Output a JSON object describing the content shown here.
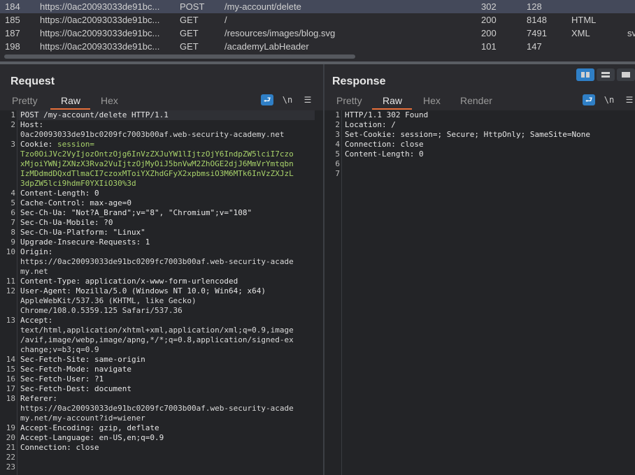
{
  "history": {
    "rows": [
      {
        "num": "184",
        "host": "https://0ac20093033de91bc...",
        "method": "POST",
        "url": "/my-account/delete",
        "status": "302",
        "length": "128",
        "mime": "",
        "ext": "",
        "selected": true
      },
      {
        "num": "185",
        "host": "https://0ac20093033de91bc...",
        "method": "GET",
        "url": "/",
        "status": "200",
        "length": "8148",
        "mime": "HTML",
        "ext": ""
      },
      {
        "num": "187",
        "host": "https://0ac20093033de91bc...",
        "method": "GET",
        "url": "/resources/images/blog.svg",
        "status": "200",
        "length": "7491",
        "mime": "XML",
        "ext": "sv"
      },
      {
        "num": "198",
        "host": "https://0ac20093033de91bc...",
        "method": "GET",
        "url": "/academyLabHeader",
        "status": "101",
        "length": "147",
        "mime": "",
        "ext": ""
      }
    ]
  },
  "request": {
    "title": "Request",
    "tabs": [
      "Pretty",
      "Raw",
      "Hex"
    ],
    "active_tab": "Raw",
    "wrap_icon": "wrap-lines-icon",
    "newline_label": "\\n",
    "menu_icon": "hamburger-menu-icon",
    "lines": [
      {
        "n": "1",
        "segs": [
          {
            "t": "POST /my-account/delete HTTP/1.1",
            "c": "k"
          }
        ]
      },
      {
        "n": "2",
        "segs": [
          {
            "t": "Host:",
            "c": "k"
          }
        ]
      },
      {
        "n": "",
        "segs": [
          {
            "t": "0ac20093033de91bc0209fc7003b00af.web-security-academy.net",
            "c": "v"
          }
        ]
      },
      {
        "n": "3",
        "segs": [
          {
            "t": "Cookie: ",
            "c": "k"
          },
          {
            "t": "session=",
            "c": "cv"
          }
        ]
      },
      {
        "n": "",
        "segs": [
          {
            "t": "Tzo0OiJVc2VyIjozOntzOjg6InVzZXJuYW1lIjtzOjY6IndpZW5lciI7czo",
            "c": "cv"
          }
        ]
      },
      {
        "n": "",
        "segs": [
          {
            "t": "xMjoiYWNjZXNzX3Rva2VuIjtzOjMyOiJ5bnVwM2ZhOGE2djJ6MmVrYmtqbn",
            "c": "cv"
          }
        ]
      },
      {
        "n": "",
        "segs": [
          {
            "t": "IzMDdmdDQxdTlmaCI7czoxMToiYXZhdGFyX2xpbmsiO3M6MTk6InVzZXJzL",
            "c": "cv"
          }
        ]
      },
      {
        "n": "",
        "segs": [
          {
            "t": "3dpZW5lci9hdmF0YXIiO30%3d",
            "c": "cv"
          }
        ]
      },
      {
        "n": "4",
        "segs": [
          {
            "t": "Content-Length: 0",
            "c": "k"
          }
        ]
      },
      {
        "n": "5",
        "segs": [
          {
            "t": "Cache-Control: max-age=0",
            "c": "k"
          }
        ]
      },
      {
        "n": "6",
        "segs": [
          {
            "t": "Sec-Ch-Ua: \"Not?A_Brand\";v=\"8\", \"Chromium\";v=\"108\"",
            "c": "k"
          }
        ]
      },
      {
        "n": "7",
        "segs": [
          {
            "t": "Sec-Ch-Ua-Mobile: ?0",
            "c": "k"
          }
        ]
      },
      {
        "n": "8",
        "segs": [
          {
            "t": "Sec-Ch-Ua-Platform: \"Linux\"",
            "c": "k"
          }
        ]
      },
      {
        "n": "9",
        "segs": [
          {
            "t": "Upgrade-Insecure-Requests: 1",
            "c": "k"
          }
        ]
      },
      {
        "n": "10",
        "segs": [
          {
            "t": "Origin:",
            "c": "k"
          }
        ]
      },
      {
        "n": "",
        "segs": [
          {
            "t": "https://0ac20093033de91bc0209fc7003b00af.web-security-acade",
            "c": "v"
          }
        ]
      },
      {
        "n": "",
        "segs": [
          {
            "t": "my.net",
            "c": "v"
          }
        ]
      },
      {
        "n": "11",
        "segs": [
          {
            "t": "Content-Type: application/x-www-form-urlencoded",
            "c": "k"
          }
        ]
      },
      {
        "n": "12",
        "segs": [
          {
            "t": "User-Agent: Mozilla/5.0 (Windows NT 10.0; Win64; x64)",
            "c": "k"
          }
        ]
      },
      {
        "n": "",
        "segs": [
          {
            "t": "AppleWebKit/537.36 (KHTML, like Gecko)",
            "c": "v"
          }
        ]
      },
      {
        "n": "",
        "segs": [
          {
            "t": "Chrome/108.0.5359.125 Safari/537.36",
            "c": "v"
          }
        ]
      },
      {
        "n": "13",
        "segs": [
          {
            "t": "Accept:",
            "c": "k"
          }
        ]
      },
      {
        "n": "",
        "segs": [
          {
            "t": "text/html,application/xhtml+xml,application/xml;q=0.9,image",
            "c": "v"
          }
        ]
      },
      {
        "n": "",
        "segs": [
          {
            "t": "/avif,image/webp,image/apng,*/*;q=0.8,application/signed-ex",
            "c": "v"
          }
        ]
      },
      {
        "n": "",
        "segs": [
          {
            "t": "change;v=b3;q=0.9",
            "c": "v"
          }
        ]
      },
      {
        "n": "14",
        "segs": [
          {
            "t": "Sec-Fetch-Site: same-origin",
            "c": "k"
          }
        ]
      },
      {
        "n": "15",
        "segs": [
          {
            "t": "Sec-Fetch-Mode: navigate",
            "c": "k"
          }
        ]
      },
      {
        "n": "16",
        "segs": [
          {
            "t": "Sec-Fetch-User: ?1",
            "c": "k"
          }
        ]
      },
      {
        "n": "17",
        "segs": [
          {
            "t": "Sec-Fetch-Dest: document",
            "c": "k"
          }
        ]
      },
      {
        "n": "18",
        "segs": [
          {
            "t": "Referer:",
            "c": "k"
          }
        ]
      },
      {
        "n": "",
        "segs": [
          {
            "t": "https://0ac20093033de91bc0209fc7003b00af.web-security-acade",
            "c": "v"
          }
        ]
      },
      {
        "n": "",
        "segs": [
          {
            "t": "my.net/my-account?id=wiener",
            "c": "v"
          }
        ]
      },
      {
        "n": "19",
        "segs": [
          {
            "t": "Accept-Encoding: gzip, deflate",
            "c": "k"
          }
        ]
      },
      {
        "n": "20",
        "segs": [
          {
            "t": "Accept-Language: en-US,en;q=0.9",
            "c": "k"
          }
        ]
      },
      {
        "n": "21",
        "segs": [
          {
            "t": "Connection: close",
            "c": "k"
          }
        ]
      },
      {
        "n": "22",
        "segs": []
      },
      {
        "n": "23",
        "segs": []
      }
    ]
  },
  "response": {
    "title": "Response",
    "tabs": [
      "Pretty",
      "Raw",
      "Hex",
      "Render"
    ],
    "active_tab": "Raw",
    "wrap_icon": "wrap-lines-icon",
    "newline_label": "\\n",
    "menu_icon": "hamburger-menu-icon",
    "lines": [
      {
        "n": "1",
        "segs": [
          {
            "t": "HTTP/1.1 302 Found",
            "c": "k"
          }
        ]
      },
      {
        "n": "2",
        "segs": [
          {
            "t": "Location: /",
            "c": "k"
          }
        ]
      },
      {
        "n": "3",
        "segs": [
          {
            "t": "Set-Cookie: session=; Secure; HttpOnly; SameSite=None",
            "c": "k"
          }
        ]
      },
      {
        "n": "4",
        "segs": [
          {
            "t": "Connection: close",
            "c": "k"
          }
        ]
      },
      {
        "n": "5",
        "segs": [
          {
            "t": "Content-Length: 0",
            "c": "k"
          }
        ]
      },
      {
        "n": "6",
        "segs": []
      },
      {
        "n": "7",
        "segs": []
      }
    ]
  },
  "layout_toggle": {
    "icons": [
      "split-horizontal-icon",
      "split-vertical-icon",
      "single-pane-icon"
    ]
  },
  "colors": {
    "accent": "#e8703a",
    "selection": "#44495a",
    "button_blue": "#2f7fc6",
    "cookie_green": "#a9d36b"
  }
}
